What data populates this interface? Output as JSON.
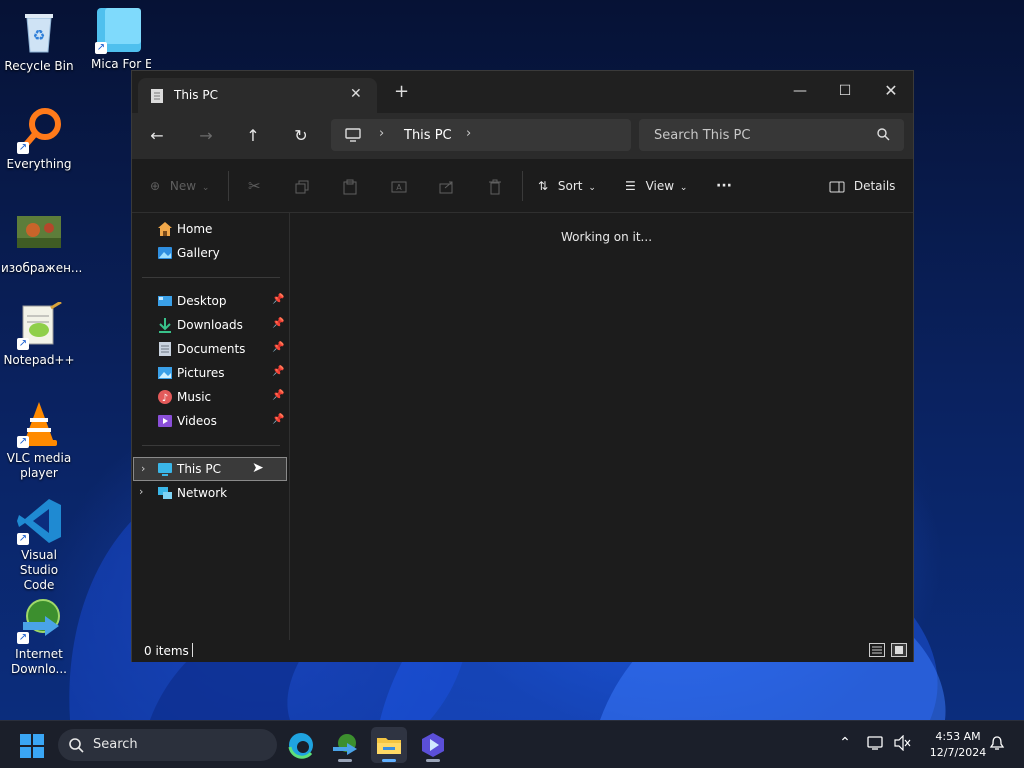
{
  "desktop": {
    "icons": [
      {
        "label": "Recycle Bin"
      },
      {
        "label": "Mica For Everyone"
      },
      {
        "label": "Everything"
      },
      {
        "label": "изображен..."
      },
      {
        "label": "Notepad++"
      },
      {
        "label": "VLC media player"
      },
      {
        "label": "Visual Studio Code"
      },
      {
        "label": "Internet Downlo..."
      }
    ]
  },
  "window": {
    "tab_title": "This PC",
    "new_tab_label": "+",
    "address": {
      "crumb": "This PC"
    },
    "search": {
      "placeholder": "Search This PC"
    },
    "toolbar": {
      "new_label": "New",
      "sort_label": "Sort",
      "view_label": "View",
      "more_label": "···",
      "details_label": "Details"
    },
    "sidebar": {
      "top": [
        {
          "label": "Home"
        },
        {
          "label": "Gallery"
        }
      ],
      "pinned": [
        {
          "label": "Desktop"
        },
        {
          "label": "Downloads"
        },
        {
          "label": "Documents"
        },
        {
          "label": "Pictures"
        },
        {
          "label": "Music"
        },
        {
          "label": "Videos"
        }
      ],
      "tree": [
        {
          "label": "This PC"
        },
        {
          "label": "Network"
        }
      ]
    },
    "content": {
      "message": "Working on it..."
    },
    "status": {
      "item_count": "0 items"
    }
  },
  "taskbar": {
    "search_label": "Search",
    "time": "4:53 AM",
    "date": "12/7/2024"
  },
  "colors": {
    "accent": "#60b0ff",
    "window_bg": "#1c1c1c",
    "titlebar_bg": "#202020",
    "nav_bg": "#2b2b2b",
    "taskbar_bg": "#1b1f2a"
  }
}
